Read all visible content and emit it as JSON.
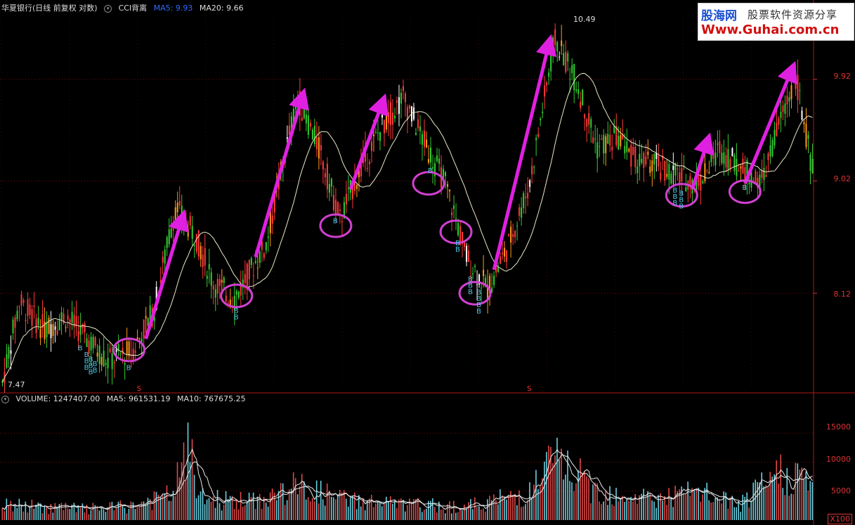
{
  "header": {
    "stock_title": "华夏银行(日线 前复权 对数)",
    "indicator_name": "CCI背离",
    "ma5_label": "MA5: 9.93",
    "ma20_label": "MA20: 9.66"
  },
  "volume_header": {
    "text": "VOLUME: 1247407.00",
    "ma5": "MA5: 961531.19",
    "ma10": "MA10: 767675.25"
  },
  "brand": {
    "name": "股海网",
    "slogan": "股票软件资源分享",
    "url": "Www.Guhai.com.cn"
  },
  "annotations": {
    "high_label": "10.49",
    "low_label": "7.47",
    "buy_mark": "B",
    "sell_mark": "S",
    "unit_label": "X100"
  },
  "colors": {
    "up": "#ff3a3a",
    "down": "#33cc33",
    "orange": "#ff9a1a",
    "white": "#ffffff",
    "ma_line": "#e8e8c8",
    "arrow": "#e020e0",
    "circle": "#d040d0",
    "buy": "#4dc8e8",
    "sell": "#ff3030",
    "grid": "#7a1010"
  },
  "chart_data": {
    "type": "candlestick+volume",
    "price_axis": {
      "scale": "log",
      "ticks": [
        8.12,
        9.02,
        9.92
      ],
      "range": [
        7.47,
        10.49
      ]
    },
    "volume_axis": {
      "ticks": [
        5000,
        10000,
        15000
      ],
      "unit": "X100"
    },
    "price_anchor_points": [
      {
        "i": 0,
        "v": 7.47
      },
      {
        "i": 8,
        "v": 8.05
      },
      {
        "i": 20,
        "v": 7.85
      },
      {
        "i": 30,
        "v": 7.95
      },
      {
        "i": 40,
        "v": 7.78
      },
      {
        "i": 50,
        "v": 7.62
      },
      {
        "i": 62,
        "v": 7.7
      },
      {
        "i": 72,
        "v": 8.0
      },
      {
        "i": 82,
        "v": 8.8
      },
      {
        "i": 92,
        "v": 8.55
      },
      {
        "i": 100,
        "v": 8.2
      },
      {
        "i": 110,
        "v": 8.08
      },
      {
        "i": 125,
        "v": 8.5
      },
      {
        "i": 140,
        "v": 9.75
      },
      {
        "i": 150,
        "v": 9.3
      },
      {
        "i": 160,
        "v": 8.7
      },
      {
        "i": 168,
        "v": 9.05
      },
      {
        "i": 180,
        "v": 9.5
      },
      {
        "i": 190,
        "v": 9.75
      },
      {
        "i": 200,
        "v": 9.35
      },
      {
        "i": 210,
        "v": 9.0
      },
      {
        "i": 220,
        "v": 8.4
      },
      {
        "i": 230,
        "v": 8.15
      },
      {
        "i": 240,
        "v": 8.5
      },
      {
        "i": 250,
        "v": 9.0
      },
      {
        "i": 262,
        "v": 10.3
      },
      {
        "i": 272,
        "v": 9.9
      },
      {
        "i": 282,
        "v": 9.3
      },
      {
        "i": 292,
        "v": 9.4
      },
      {
        "i": 300,
        "v": 9.2
      },
      {
        "i": 310,
        "v": 9.15
      },
      {
        "i": 322,
        "v": 9.05
      },
      {
        "i": 330,
        "v": 9.0
      },
      {
        "i": 340,
        "v": 9.3
      },
      {
        "i": 352,
        "v": 9.1
      },
      {
        "i": 360,
        "v": 9.0
      },
      {
        "i": 368,
        "v": 9.5
      },
      {
        "i": 376,
        "v": 9.95
      },
      {
        "i": 384,
        "v": 9.1
      }
    ],
    "buy_signals": [
      {
        "i": 37,
        "count": 1
      },
      {
        "i": 40,
        "count": 3
      },
      {
        "i": 42,
        "count": 3
      },
      {
        "i": 44,
        "count": 2
      },
      {
        "i": 60,
        "count": 1
      },
      {
        "i": 111,
        "count": 2
      },
      {
        "i": 158,
        "count": 1
      },
      {
        "i": 203,
        "count": 1
      },
      {
        "i": 216,
        "count": 2
      },
      {
        "i": 222,
        "count": 3
      },
      {
        "i": 226,
        "count": 4
      },
      {
        "i": 319,
        "count": 3
      },
      {
        "i": 322,
        "count": 3
      },
      {
        "i": 352,
        "count": 1
      }
    ],
    "sell_signals": [
      {
        "i": 65
      },
      {
        "i": 250
      }
    ],
    "highlight_circles": [
      {
        "i": 60,
        "v": 7.7
      },
      {
        "i": 111,
        "v": 8.1
      },
      {
        "i": 158,
        "v": 8.65
      },
      {
        "i": 202,
        "v": 9.0
      },
      {
        "i": 215,
        "v": 8.6
      },
      {
        "i": 224,
        "v": 8.12
      },
      {
        "i": 322,
        "v": 8.9
      },
      {
        "i": 352,
        "v": 8.93
      }
    ],
    "trend_arrows": [
      {
        "from": {
          "i": 68,
          "v": 7.78
        },
        "to": {
          "i": 85,
          "v": 8.7
        }
      },
      {
        "from": {
          "i": 120,
          "v": 8.4
        },
        "to": {
          "i": 142,
          "v": 9.75
        }
      },
      {
        "from": {
          "i": 165,
          "v": 8.95
        },
        "to": {
          "i": 180,
          "v": 9.7
        }
      },
      {
        "from": {
          "i": 233,
          "v": 8.3
        },
        "to": {
          "i": 259,
          "v": 10.25
        }
      },
      {
        "from": {
          "i": 327,
          "v": 8.95
        },
        "to": {
          "i": 334,
          "v": 9.35
        }
      },
      {
        "from": {
          "i": 352,
          "v": 9.0
        },
        "to": {
          "i": 374,
          "v": 10.0
        }
      }
    ],
    "volume_anchor_points": [
      {
        "i": 0,
        "v": 2500
      },
      {
        "i": 40,
        "v": 1800
      },
      {
        "i": 60,
        "v": 2200
      },
      {
        "i": 80,
        "v": 4000
      },
      {
        "i": 88,
        "v": 11000
      },
      {
        "i": 95,
        "v": 3500
      },
      {
        "i": 120,
        "v": 3000
      },
      {
        "i": 140,
        "v": 5500
      },
      {
        "i": 160,
        "v": 3500
      },
      {
        "i": 190,
        "v": 2500
      },
      {
        "i": 220,
        "v": 2200
      },
      {
        "i": 250,
        "v": 4500
      },
      {
        "i": 262,
        "v": 10000
      },
      {
        "i": 280,
        "v": 5000
      },
      {
        "i": 310,
        "v": 3500
      },
      {
        "i": 330,
        "v": 4500
      },
      {
        "i": 350,
        "v": 2500
      },
      {
        "i": 370,
        "v": 8000
      },
      {
        "i": 384,
        "v": 6000
      }
    ]
  }
}
